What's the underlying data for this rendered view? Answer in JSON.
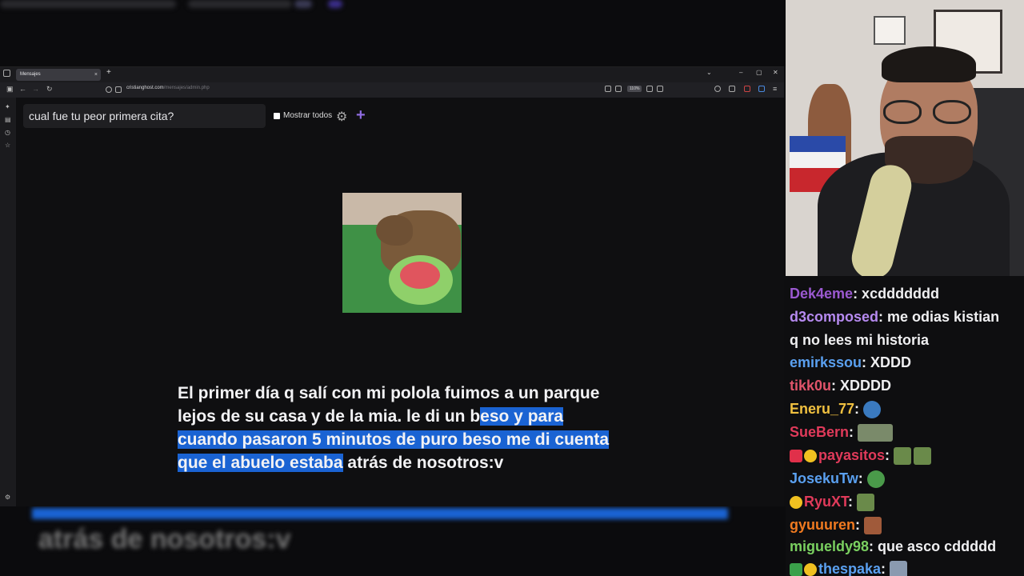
{
  "browser": {
    "tab_title": "Mensajes",
    "new_tab": "+",
    "close_tab": "×",
    "url_host": "cristianghost.com",
    "url_path": "/mensajes/admin.php",
    "zoom": "110%",
    "window_controls": [
      "–",
      "▢",
      "✕"
    ]
  },
  "page": {
    "question": "cual fue tu peor primera cita?",
    "show_all_label": "Mostrar todos",
    "message_part1": "El primer día q salí con mi polola fuimos a un parque lejos de su casa y de la mia. le di un b",
    "message_selected": "eso y para cuando pasaron 5 minutos de puro beso me di cuenta que el abuelo estaba",
    "message_part2": " atrás de nosotros:v"
  },
  "lower_echo": {
    "text": "atrás de nosotros:v"
  },
  "chat": {
    "messages": [
      {
        "user": "Dek4eme",
        "color": "#9b59d0",
        "text": ": xcddddddd"
      },
      {
        "user": "d3composed",
        "color": "#b68af0",
        "text": ": me odias kistian"
      },
      {
        "user": "",
        "color": "#efeff1",
        "text": "q no lees mi historia"
      },
      {
        "user": "emirkssou",
        "color": "#5aa0f0",
        "text": ": XDDD"
      },
      {
        "user": "tikk0u",
        "color": "#e0546a",
        "text": ": XDDDD"
      },
      {
        "user": "Eneru_77",
        "color": "#f0c040",
        "text": ":"
      },
      {
        "user": "SueBern",
        "color": "#e03a5a",
        "text": ":"
      },
      {
        "user": "payasitos",
        "color": "#e03a5a",
        "text": ":"
      },
      {
        "user": "JosekuTw",
        "color": "#5aa0f0",
        "text": ":"
      },
      {
        "user": "RyuXT",
        "color": "#e03a5a",
        "text": ":"
      },
      {
        "user": "gyuuuren",
        "color": "#f07a20",
        "text": ":"
      },
      {
        "user": "migueldy98",
        "color": "#7ad060",
        "text": ": que asco cddddd"
      },
      {
        "user": "thespaka",
        "color": "#5aa0f0",
        "text": ":"
      }
    ]
  }
}
